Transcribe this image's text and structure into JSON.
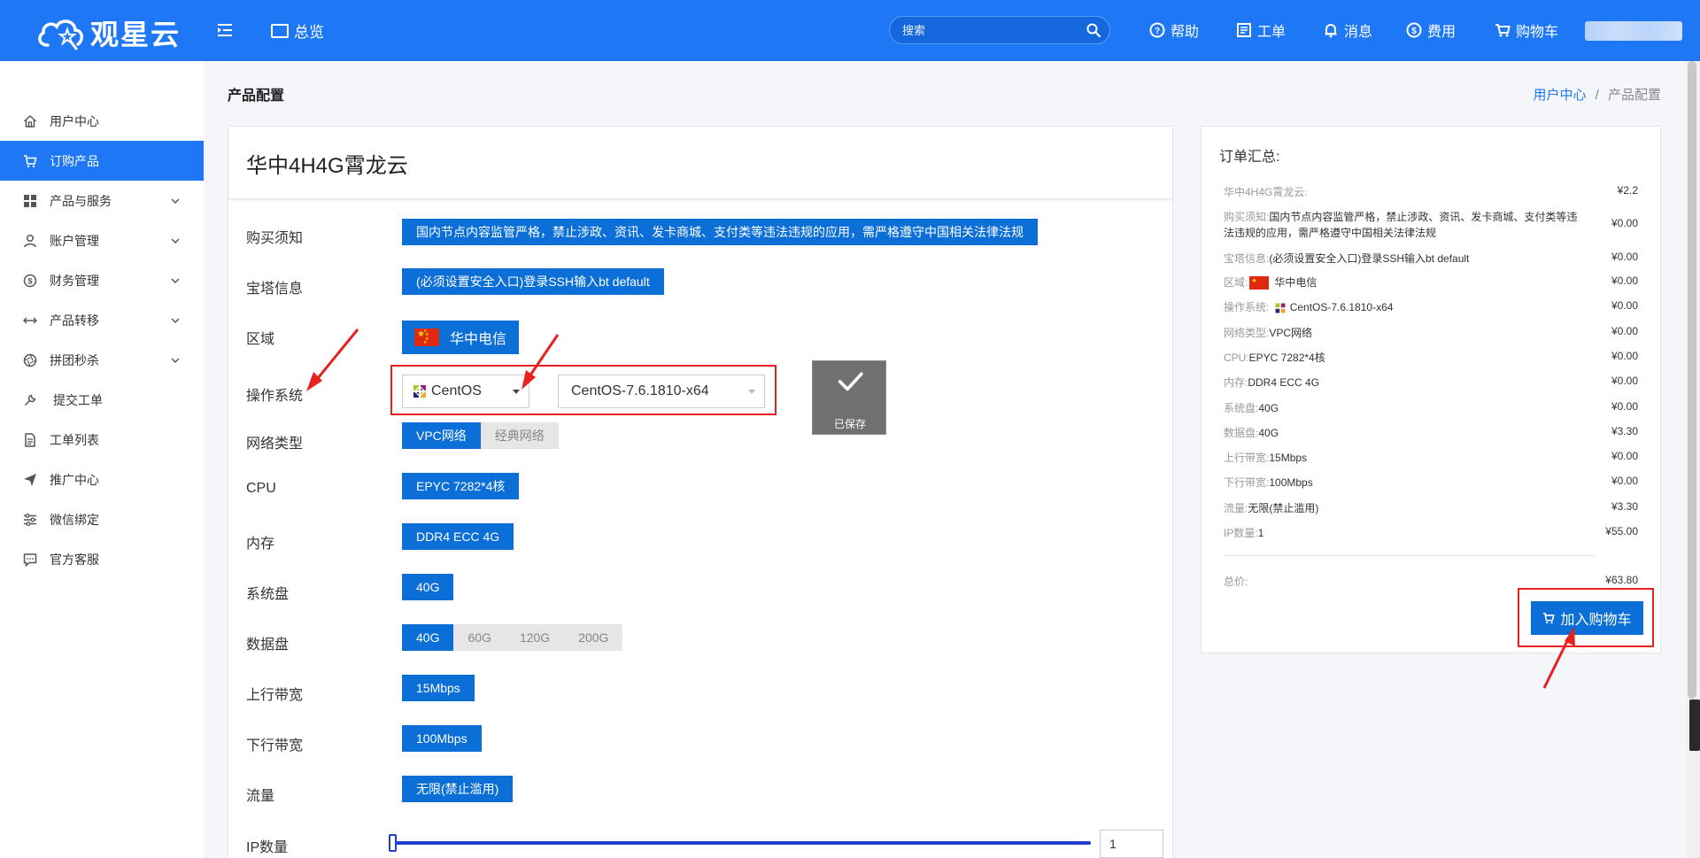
{
  "brand": {
    "name": "观星云"
  },
  "topbar": {
    "overview_label": "总览",
    "search_placeholder": "搜索",
    "nav": [
      {
        "label": "帮助",
        "icon": "help-icon"
      },
      {
        "label": "工单",
        "icon": "ticket-icon"
      },
      {
        "label": "消息",
        "icon": "bell-icon"
      },
      {
        "label": "费用",
        "icon": "dollar-icon"
      },
      {
        "label": "购物车",
        "icon": "cart-icon"
      }
    ]
  },
  "sidebar": {
    "items": [
      {
        "label": "用户中心",
        "icon": "home-icon",
        "active": false,
        "expandable": false
      },
      {
        "label": "订购产品",
        "icon": "cart-icon",
        "active": true,
        "expandable": false
      },
      {
        "label": "产品与服务",
        "icon": "grid-icon",
        "active": false,
        "expandable": true
      },
      {
        "label": "账户管理",
        "icon": "user-icon",
        "active": false,
        "expandable": true
      },
      {
        "label": "财务管理",
        "icon": "dollar-icon",
        "active": false,
        "expandable": true
      },
      {
        "label": "产品转移",
        "icon": "transfer-icon",
        "active": false,
        "expandable": true
      },
      {
        "label": "拼团秒杀",
        "icon": "aperture-icon",
        "active": false,
        "expandable": true
      },
      {
        "label": "提交工单",
        "icon": "wrench-icon",
        "active": false,
        "expandable": false
      },
      {
        "label": "工单列表",
        "icon": "document-icon",
        "active": false,
        "expandable": false
      },
      {
        "label": "推广中心",
        "icon": "send-icon",
        "active": false,
        "expandable": false
      },
      {
        "label": "微信绑定",
        "icon": "sliders-icon",
        "active": false,
        "expandable": false
      },
      {
        "label": "官方客服",
        "icon": "chat-icon",
        "active": false,
        "expandable": false
      }
    ]
  },
  "page": {
    "title": "产品配置",
    "breadcrumb": {
      "link": "用户中心",
      "separator": "/",
      "current": "产品配置"
    }
  },
  "product": {
    "name": "华中4H4G霄龙云",
    "rows": {
      "notice": {
        "label": "购买须知",
        "value": "国内节点内容监管严格，禁止涉政、资讯、发卡商城、支付类等违法违规的应用，需严格遵守中国相关法律法规"
      },
      "bt": {
        "label": "宝塔信息",
        "value": "(必须设置安全入口)登录SSH输入bt default"
      },
      "region": {
        "label": "区域",
        "value": "华中电信"
      },
      "os": {
        "label": "操作系统",
        "family": "CentOS",
        "version": "CentOS-7.6.1810-x64",
        "saved_label": "已保存"
      },
      "network": {
        "label": "网络类型",
        "options": [
          "VPC网络",
          "经典网络"
        ],
        "selected": 0
      },
      "cpu": {
        "label": "CPU",
        "value": "EPYC 7282*4核"
      },
      "memory": {
        "label": "内存",
        "value": "DDR4 ECC 4G"
      },
      "system_disk": {
        "label": "系统盘",
        "value": "40G"
      },
      "data_disk": {
        "label": "数据盘",
        "options": [
          "40G",
          "60G",
          "120G",
          "200G"
        ],
        "selected": 0
      },
      "upload": {
        "label": "上行带宽",
        "value": "15Mbps"
      },
      "download": {
        "label": "下行带宽",
        "value": "100Mbps"
      },
      "traffic": {
        "label": "流量",
        "value": "无限(禁止滥用)"
      },
      "ip": {
        "label": "IP数量",
        "value": "1",
        "slider_fraction": 0
      }
    }
  },
  "summary": {
    "title": "订单汇总:",
    "lines": [
      {
        "key": "华中4H4G霄龙云:",
        "text": "",
        "price": "¥2.2"
      },
      {
        "key": "购买须知:",
        "text": "国内节点内容监管严格，禁止涉政、资讯、发卡商城、支付类等违法违规的应用，需严格遵守中国相关法律法规",
        "price": "¥0.00"
      },
      {
        "key": "宝塔信息:",
        "text": "(必须设置安全入口)登录SSH输入bt default",
        "price": "¥0.00"
      },
      {
        "key": "区域:",
        "text": "华中电信",
        "price": "¥0.00"
      },
      {
        "key": "操作系统:",
        "text": "CentOS-7.6.1810-x64",
        "price": "¥0.00"
      },
      {
        "key": "网络类型:",
        "text": "VPC网络",
        "price": "¥0.00"
      },
      {
        "key": "CPU:",
        "text": "EPYC 7282*4核",
        "price": "¥0.00"
      },
      {
        "key": "内存:",
        "text": "DDR4 ECC 4G",
        "price": "¥0.00"
      },
      {
        "key": "系统盘:",
        "text": "40G",
        "price": "¥0.00"
      },
      {
        "key": "数据盘:",
        "text": "40G",
        "price": "¥3.30"
      },
      {
        "key": "上行带宽:",
        "text": "15Mbps",
        "price": "¥0.00"
      },
      {
        "key": "下行带宽:",
        "text": "100Mbps",
        "price": "¥0.00"
      },
      {
        "key": "流量:",
        "text": "无限(禁止滥用)",
        "price": "¥3.30"
      },
      {
        "key": "IP数量:",
        "text": "1",
        "price": "¥55.00"
      }
    ],
    "total_label": "总价:",
    "total_value": "¥63.80",
    "cart_button": "加入购物车"
  },
  "colors": {
    "primary": "#1e78f5",
    "tag": "#0b6fd7",
    "highlight": "#e8211e"
  }
}
